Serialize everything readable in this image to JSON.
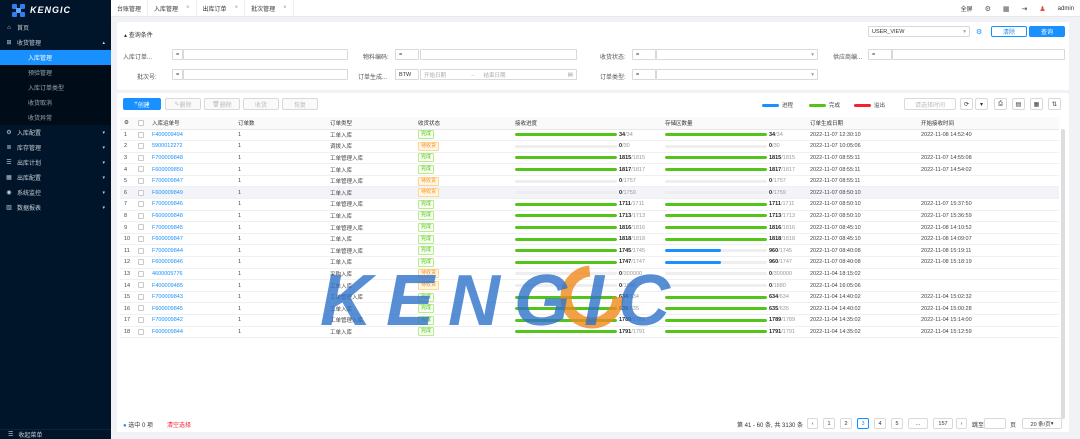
{
  "brand": {
    "logo_text": "KENGIC",
    "watermark_text": "KENGIC"
  },
  "sidebar": {
    "items": [
      {
        "label": "首页",
        "icon": "home-icon"
      },
      {
        "label": "收货管理",
        "icon": "inbox-icon",
        "expanded": true,
        "children": [
          {
            "label": "入库管理",
            "active": true
          },
          {
            "label": "预验管理"
          },
          {
            "label": "入库订单类型"
          },
          {
            "label": "收货取消"
          },
          {
            "label": "收货异常"
          }
        ]
      },
      {
        "label": "入库配置",
        "icon": "settings-icon"
      },
      {
        "label": "库存管理",
        "icon": "database-icon"
      },
      {
        "label": "出库计划",
        "icon": "list-icon"
      },
      {
        "label": "出库配置",
        "icon": "grid-icon"
      },
      {
        "label": "系统监控",
        "icon": "monitor-icon"
      },
      {
        "label": "数据报表",
        "icon": "chart-icon"
      }
    ],
    "bottom_label": "收起菜单"
  },
  "tabs": [
    {
      "label": "台账管理",
      "closable": false
    },
    {
      "label": "入库管理",
      "closable": true
    },
    {
      "label": "出库订单",
      "closable": true
    },
    {
      "label": "批次管理",
      "closable": true
    }
  ],
  "topbar": {
    "lang": "全屏",
    "user": "admin"
  },
  "query": {
    "title": "查询条件",
    "view_select": "USER_VIEW",
    "clear_label": "清除",
    "search_label": "查询",
    "fields": {
      "order_no": "入库订单...",
      "material_code": "物料编码:",
      "receive_status": "收货状态:",
      "supplier": "供应商编...",
      "batch_no": "批次号:",
      "order_gen": "订单生成...",
      "order_type": "订单类型:"
    },
    "op": "=",
    "date_op": "BTW",
    "date_start": "开始日期",
    "date_end": "结束日期"
  },
  "toolbar": {
    "create": "创建",
    "edit": "删除",
    "delete": "删除",
    "receive": "收货",
    "restore": "恢复",
    "time_placeholder": "请选择时间"
  },
  "legend": [
    {
      "label": "进程",
      "color": "#1890ff"
    },
    {
      "label": "完成",
      "color": "#52c41a"
    },
    {
      "label": "溢出",
      "color": "#f5222d"
    }
  ],
  "table": {
    "headers": [
      "",
      "入库运单号",
      "订单数",
      "订单类型",
      "收货状态",
      "接收进度",
      "存储区数量",
      "订单生成日期",
      "开始接收时间"
    ],
    "rows": [
      {
        "no": "1",
        "id": "F400009494",
        "qty": "1",
        "type": "工单入库",
        "status": "完成",
        "recv": [
          34,
          34
        ],
        "store": [
          34,
          34
        ],
        "gen": "2022-11-07 12:30:10",
        "start": "2022-11-08 14:52:40"
      },
      {
        "no": "2",
        "id": "5900012272",
        "qty": "1",
        "type": "调拨入库",
        "status": "待收货",
        "recv": [
          0,
          30
        ],
        "store": [
          0,
          30
        ],
        "gen": "2022-11-07 10:05:06",
        "start": ""
      },
      {
        "no": "3",
        "id": "F700009848",
        "qty": "1",
        "type": "工单管理入库",
        "status": "完成",
        "recv": [
          1815,
          1815
        ],
        "store": [
          1815,
          1815
        ],
        "gen": "2022-11-07 08:55:11",
        "start": "2022-11-07 14:55:08"
      },
      {
        "no": "4",
        "id": "F600009850",
        "qty": "1",
        "type": "工单入库",
        "status": "完成",
        "recv": [
          1817,
          1817
        ],
        "store": [
          1817,
          1817
        ],
        "gen": "2022-11-07 08:55:11",
        "start": "2022-11-07 14:54:02"
      },
      {
        "no": "5",
        "id": "F700009847",
        "qty": "1",
        "type": "工单管理入库",
        "status": "待收货",
        "recv": [
          0,
          1757
        ],
        "store": [
          0,
          1757
        ],
        "gen": "2022-11-07 08:55:11",
        "start": ""
      },
      {
        "no": "6",
        "id": "F600009849",
        "qty": "1",
        "type": "工单入库",
        "status": "待收货",
        "recv": [
          0,
          1759
        ],
        "store": [
          0,
          1759
        ],
        "gen": "2022-11-07 08:50:10",
        "start": "",
        "hl": true
      },
      {
        "no": "7",
        "id": "F700009846",
        "qty": "1",
        "type": "工单管理入库",
        "status": "完成",
        "recv": [
          1711,
          1711
        ],
        "store": [
          1711,
          1711
        ],
        "gen": "2022-11-07 08:50:10",
        "start": "2022-11-07 15:37:50"
      },
      {
        "no": "8",
        "id": "F600009848",
        "qty": "1",
        "type": "工单入库",
        "status": "完成",
        "recv": [
          1713,
          1713
        ],
        "store": [
          1713,
          1713
        ],
        "gen": "2022-11-07 08:50:10",
        "start": "2022-11-07 15:36:59"
      },
      {
        "no": "9",
        "id": "F700009845",
        "qty": "1",
        "type": "工单管理入库",
        "status": "完成",
        "recv": [
          1816,
          1816
        ],
        "store": [
          1816,
          1816
        ],
        "gen": "2022-11-07 08:45:10",
        "start": "2022-11-08 14:10:52"
      },
      {
        "no": "10",
        "id": "F600009847",
        "qty": "1",
        "type": "工单入库",
        "status": "完成",
        "recv": [
          1818,
          1818
        ],
        "store": [
          1818,
          1818
        ],
        "gen": "2022-11-07 08:45:10",
        "start": "2022-11-08 14:09:07"
      },
      {
        "no": "11",
        "id": "F700009844",
        "qty": "1",
        "type": "工单管理入库",
        "status": "完成",
        "recv": [
          1745,
          1745
        ],
        "store": [
          960,
          1745
        ],
        "gen": "2022-11-07 08:40:08",
        "start": "2022-11-08 15:19:11"
      },
      {
        "no": "12",
        "id": "F600009846",
        "qty": "1",
        "type": "工单入库",
        "status": "完成",
        "recv": [
          1747,
          1747
        ],
        "store": [
          960,
          1747
        ],
        "gen": "2022-11-07 08:40:08",
        "start": "2022-11-08 15:18:19"
      },
      {
        "no": "13",
        "id": "4600005776",
        "qty": "1",
        "type": "采购入库",
        "status": "待收货",
        "recv": [
          0,
          300000
        ],
        "store": [
          0,
          300000
        ],
        "gen": "2022-11-04 18:15:02",
        "start": ""
      },
      {
        "no": "14",
        "id": "F400009485",
        "qty": "1",
        "type": "工单入库",
        "status": "待收货",
        "recv": [
          0,
          1880
        ],
        "store": [
          0,
          1880
        ],
        "gen": "2022-11-04 16:05:06",
        "start": ""
      },
      {
        "no": "15",
        "id": "F700009843",
        "qty": "1",
        "type": "工单管理入库",
        "status": "完成",
        "recv": [
          634,
          634
        ],
        "store": [
          634,
          634
        ],
        "gen": "2022-11-04 14:40:02",
        "start": "2022-11-04 15:02:32"
      },
      {
        "no": "16",
        "id": "F600009845",
        "qty": "1",
        "type": "工单入库",
        "status": "完成",
        "recv": [
          635,
          635
        ],
        "store": [
          635,
          635
        ],
        "gen": "2022-11-04 14:40:02",
        "start": "2022-11-04 15:00:28"
      },
      {
        "no": "17",
        "id": "F700009842",
        "qty": "1",
        "type": "工单管理入库",
        "status": "完成",
        "recv": [
          1789,
          1789
        ],
        "store": [
          1789,
          1789
        ],
        "gen": "2022-11-04 14:35:02",
        "start": "2022-11-04 15:14:00"
      },
      {
        "no": "18",
        "id": "F600009844",
        "qty": "1",
        "type": "工单入库",
        "status": "完成",
        "recv": [
          1791,
          1791
        ],
        "store": [
          1791,
          1791
        ],
        "gen": "2022-11-04 14:35:02",
        "start": "2022-11-04 15:12:59"
      }
    ]
  },
  "footer": {
    "selected": "选中 0 项",
    "clear_filter": "清空选择",
    "summary": "第 41 - 60 条, 共 3130 条",
    "pages": [
      "1",
      "2",
      "3",
      "4",
      "5",
      "...",
      "157"
    ],
    "current_page": "3",
    "jump_label": "跳至",
    "page_unit": "页",
    "page_size": "20 条/页"
  }
}
